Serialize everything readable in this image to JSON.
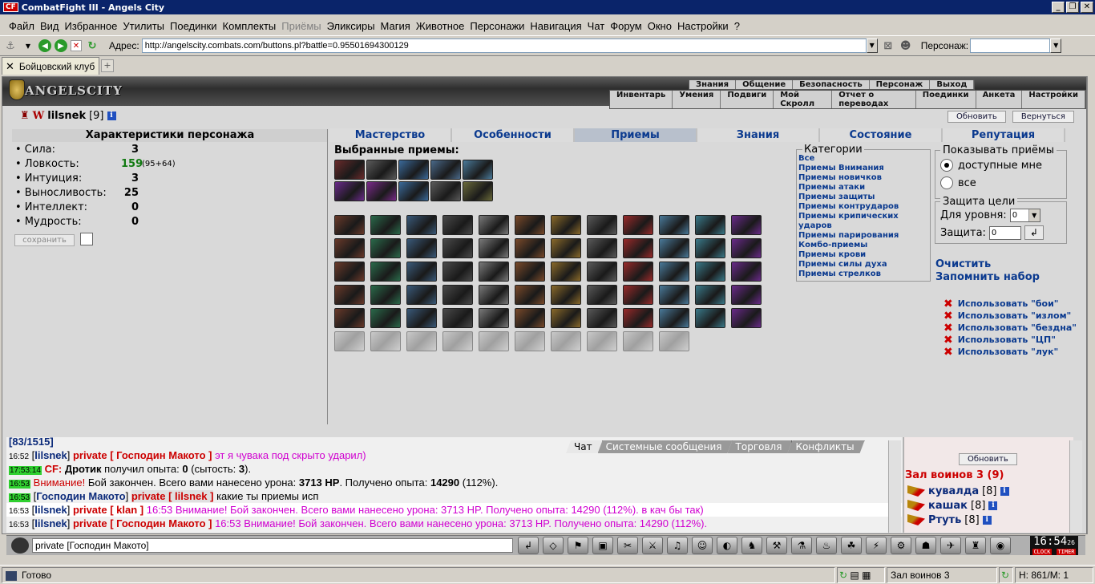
{
  "window": {
    "title": "CombatFight III - Angels City",
    "logo": "CF"
  },
  "menu": [
    "Файл",
    "Вид",
    "Избранное",
    "Утилиты",
    "Поединки",
    "Комплекты",
    "Приёмы",
    "Эликсиры",
    "Магия",
    "Животное",
    "Персонажи",
    "Навигация",
    "Чат",
    "Форум",
    "Окно",
    "Настройки",
    "?"
  ],
  "address": {
    "label": "Адрес:",
    "value": "http://angelscity.combats.com/buttons.pl?battle=0.95501694300129",
    "char_label": "Персонаж:"
  },
  "tab": {
    "label": "Бойцовский клуб"
  },
  "game": {
    "logo": "ANGELSCITY",
    "topmenu1": [
      "Знания",
      "Общение",
      "Безопасность",
      "Персонаж",
      "Выход"
    ],
    "topmenu2": [
      "Инвентарь",
      "Умения",
      "Подвиги",
      "Мой Скролл",
      "Отчет о переводах",
      "Поединки",
      "Анкета",
      "Настройки"
    ],
    "buttons": {
      "refresh": "Обновить",
      "back": "Вернуться"
    },
    "character": {
      "name": "lilsnek",
      "level": "[9]",
      "info": "i"
    },
    "stats_title": "Характеристики персонажа",
    "stats": [
      {
        "name": "• Сила:",
        "value": "3",
        "extra": ""
      },
      {
        "name": "• Ловкость:",
        "value": "159",
        "extra": "(95+64)"
      },
      {
        "name": "• Интуиция:",
        "value": "3",
        "extra": ""
      },
      {
        "name": "• Выносливость:",
        "value": "25",
        "extra": ""
      },
      {
        "name": "• Интеллект:",
        "value": "0",
        "extra": ""
      },
      {
        "name": "• Мудрость:",
        "value": "0",
        "extra": ""
      }
    ],
    "save_label": "сохранить",
    "tabs": [
      "Мастерство",
      "Особенности",
      "Приемы",
      "Знания",
      "Состояние",
      "Репутация"
    ],
    "selected_title": "Выбранные приемы:",
    "categories_title": "Категории",
    "categories": [
      "Все",
      "Приемы Внимания",
      "Приемы новичков",
      "Приемы атаки",
      "Приемы защиты",
      "Приемы контрударов",
      "Приемы крипических ударов",
      "Приемы парирования",
      "Комбо-приемы",
      "Приемы крови",
      "Приемы силы духа",
      "Приемы стрелков"
    ],
    "show_title": "Показывать приёмы",
    "show_options": [
      "доступные мне",
      "все"
    ],
    "protect_title": "Защита цели",
    "protect_level_label": "Для уровня:",
    "protect_level_value": "0",
    "protect_label": "Защита:",
    "protect_value": "0",
    "clear_label": "Очистить",
    "remember_label": "Запомнить набор",
    "uses": [
      "Использовать \"бои\"",
      "Использовать \"излом\"",
      "Использовать \"бездна\"",
      "Использовать \"ЦП\"",
      "Использовать \"лук\""
    ]
  },
  "chat": {
    "tabs": [
      "Чат",
      "Системные сообщения",
      "Торговля",
      "Конфликты"
    ],
    "first_line": "[83/1515]",
    "lines": [
      {
        "time": "16:52",
        "nick": "lilsnek",
        "tag": "private [ Господин Макото ]",
        "msg": "эт я чувака под скрыто ударил)"
      },
      {
        "time": "17:53:14",
        "cf": "CF:",
        "a": "Дротик",
        "b": "получил опыта:",
        "c": "0",
        "d": "(сытость:",
        "e": "3",
        "f": ")."
      },
      {
        "time": "16:53",
        "warn": "Внимание!",
        "text1": "Бой закончен. Всего вами нанесено урона:",
        "hp": "3713 HP",
        "text2": ". Получено опыта:",
        "exp": "14290",
        "pct": "(112%)."
      },
      {
        "time": "16:53",
        "nick": "Господин Макото",
        "tag": "private [ lilsnek ]",
        "msg": "какие ты приемы исп"
      },
      {
        "time": "16:53",
        "nick": "lilsnek",
        "tag": "private [ klan ]",
        "msg": "16:53 Внимание! Бой закончен. Всего вами нанесено урона: 3713 HP. Получено опыта: 14290 (112%). в кач бы так)"
      },
      {
        "time": "16:53",
        "nick": "lilsnek",
        "tag": "private [ Господин Макото ]",
        "msg": "16:53 Внимание! Бой закончен. Всего вами нанесено урона: 3713 HP. Получено опыта: 14290 (112%)."
      }
    ],
    "input": "private [Господин Макото]"
  },
  "room": {
    "refresh": "Обновить",
    "title": "Зал воинов 3 (9)",
    "players": [
      {
        "name": "кувалда",
        "level": "[8]"
      },
      {
        "name": "кашак",
        "level": "[8]"
      },
      {
        "name": "Ртуть",
        "level": "[8]"
      }
    ]
  },
  "clock": {
    "time": "16:54",
    "sec": "26",
    "left": "CLOCK",
    "right": "TIMER"
  },
  "status": {
    "ready": "Готово",
    "room": "Зал воинов 3",
    "hp": "H: 861/М: 1"
  }
}
